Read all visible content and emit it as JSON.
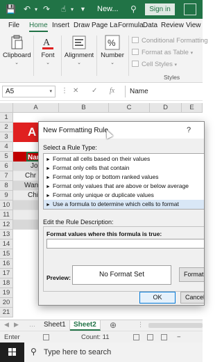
{
  "titlebar": {
    "title": "New...",
    "signin_label": "Sign in",
    "colors": {
      "accent": "#217346"
    }
  },
  "ribbon": {
    "tabs": [
      "File",
      "Home",
      "Insert",
      "Draw",
      "Page La",
      "Formula",
      "Data",
      "Review",
      "View"
    ],
    "active_tab": "Home",
    "groups": {
      "clipboard": "Clipboard",
      "font": "Font",
      "alignment": "Alignment",
      "number": "Number"
    },
    "styles": {
      "conditional_formatting": "Conditional Formatting",
      "format_as_table": "Format as Table",
      "cell_styles": "Cell Styles",
      "label": "Styles"
    }
  },
  "formula_bar": {
    "name_box": "A5",
    "fx": "fx",
    "content": "Name"
  },
  "grid": {
    "columns": [
      "A",
      "B",
      "C",
      "D",
      "E"
    ],
    "rows": [
      "1",
      "2",
      "3",
      "4",
      "5",
      "6",
      "7",
      "8",
      "9",
      "10",
      "11",
      "12",
      "13",
      "14",
      "15",
      "16",
      "17",
      "18",
      "19",
      "20",
      "21"
    ],
    "header_cell": "A",
    "name_header": "Nar",
    "names": [
      "Jo",
      "Chr",
      "Wan",
      "Chi"
    ],
    "colors": {
      "title_band": "#e02020",
      "header_band": "#c00000"
    }
  },
  "sheets": {
    "tabs": [
      "Sheet1",
      "Sheet2"
    ],
    "active": "Sheet2"
  },
  "status": {
    "mode": "Enter",
    "count": "Count: 11"
  },
  "taskbar": {
    "search_placeholder": "Type here to search"
  },
  "dialog": {
    "title": "New Formatting Rule",
    "help": "?",
    "select_rule_type_label": "Select a Rule Type:",
    "rule_types": [
      "Format all cells based on their values",
      "Format only cells that contain",
      "Format only top or bottom ranked values",
      "Format only values that are above or below average",
      "Format only unique or duplicate values",
      "Use a formula to determine which cells to format"
    ],
    "selected_rule_index": 5,
    "edit_description_label": "Edit the Rule Description:",
    "formula_label": "Format values where this formula is true:",
    "formula_value": "",
    "preview_label": "Preview:",
    "preview_text": "No Format Set",
    "format_button": "Format...",
    "ok_button": "OK",
    "cancel_button": "Cancel"
  }
}
